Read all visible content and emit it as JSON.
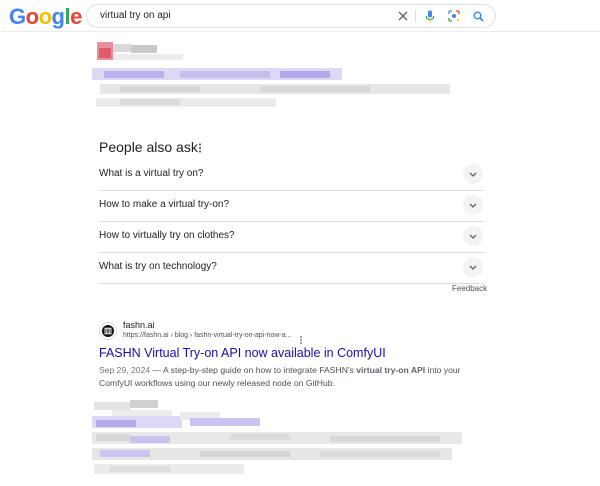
{
  "header": {
    "logo_letters": [
      {
        "char": "G",
        "color": "#4285F4"
      },
      {
        "char": "o",
        "color": "#EA4335"
      },
      {
        "char": "o",
        "color": "#FBBC05"
      },
      {
        "char": "g",
        "color": "#4285F4"
      },
      {
        "char": "l",
        "color": "#34A853"
      },
      {
        "char": "e",
        "color": "#EA4335"
      }
    ],
    "search_query": "virtual try on api",
    "icons": [
      "clear-icon",
      "mic-icon",
      "lens-icon",
      "search-icon"
    ]
  },
  "paa": {
    "title": "People also ask",
    "questions": [
      "What is a virtual try on?",
      "How to make a virtual try-on?",
      "How to virtually try on clothes?",
      "What is try on technology?"
    ],
    "feedback": "Feedback"
  },
  "result": {
    "site_name": "fashn.ai",
    "url": "https://fashn.ai › blog › fashn-virtual-try-on-api-now-a...",
    "title": "FASHN Virtual Try-on API now available in ComfyUI",
    "date": "Sep 29, 2024",
    "snippet_a": " — A step-by-step guide on how to integrate FASHN's ",
    "snippet_bold": "virtual try-on API",
    "snippet_b": " into your ComfyUI workflows using our newly released node on GitHub."
  },
  "colors": {
    "link": "#1a0dab",
    "accent_blue": "#4285F4",
    "blur_purple": "#c5c1ef"
  }
}
